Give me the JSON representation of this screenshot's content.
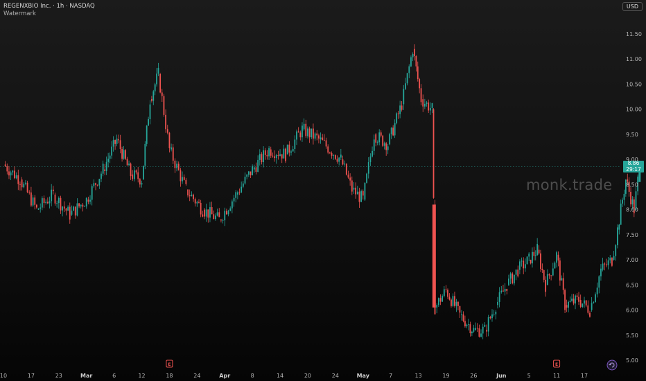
{
  "header": {
    "title": "REGENXBIO Inc. · 1h · NASDAQ",
    "subtitle": "Watermark",
    "currency": "USD"
  },
  "watermark": "monk.trade",
  "last_price": {
    "value": "8.86",
    "countdown": "29:17"
  },
  "events": [
    {
      "label": "E",
      "x_index": 6
    },
    {
      "label": "E",
      "x_index": 20
    }
  ],
  "colors": {
    "up": "#26a69a",
    "down": "#ef5350",
    "grid": "#2a2a2a",
    "axis_text": "#b4b4b4"
  },
  "chart_data": {
    "type": "candlestick",
    "title": "",
    "y_axis": {
      "ticks": [
        5.0,
        5.5,
        6.0,
        6.5,
        7.0,
        7.5,
        8.0,
        8.5,
        9.0,
        9.5,
        10.0,
        10.5,
        11.0,
        11.5
      ],
      "range": [
        5.0,
        11.9
      ]
    },
    "x_axis": {
      "ticks": [
        "10",
        "17",
        "23",
        "Mar",
        "6",
        "12",
        "18",
        "24",
        "Apr",
        "8",
        "14",
        "20",
        "24",
        "May",
        "7",
        "13",
        "19",
        "26",
        "Jun",
        "5",
        "11",
        "17"
      ],
      "major": [
        "Mar",
        "Apr",
        "May",
        "Jun"
      ]
    },
    "price_path": [
      [
        0,
        8.9
      ],
      [
        0.6,
        8.6
      ],
      [
        1.2,
        8.0
      ],
      [
        1.8,
        8.3
      ],
      [
        2.4,
        7.9
      ],
      [
        3,
        8.2
      ],
      [
        3.6,
        8.8
      ],
      [
        4.1,
        9.4
      ],
      [
        4.6,
        8.7
      ],
      [
        5.0,
        8.6
      ],
      [
        5.3,
        10.2
      ],
      [
        5.6,
        10.7
      ],
      [
        6.0,
        9.2
      ],
      [
        6.6,
        8.4
      ],
      [
        7.2,
        8.0
      ],
      [
        7.8,
        7.8
      ],
      [
        8.4,
        8.3
      ],
      [
        9.0,
        8.8
      ],
      [
        9.6,
        9.2
      ],
      [
        10.2,
        9.1
      ],
      [
        10.8,
        9.6
      ],
      [
        11.4,
        9.4
      ],
      [
        12.2,
        9.0
      ],
      [
        12.6,
        8.4
      ],
      [
        13.0,
        8.2
      ],
      [
        13.4,
        9.5
      ],
      [
        13.9,
        9.3
      ],
      [
        14.4,
        10.1
      ],
      [
        14.8,
        11.2
      ],
      [
        15.1,
        10.2
      ],
      [
        15.5,
        10.0
      ],
      [
        15.55,
        8.1
      ],
      [
        15.6,
        6.05
      ],
      [
        16.0,
        6.4
      ],
      [
        16.5,
        5.9
      ],
      [
        17.0,
        5.6
      ],
      [
        17.4,
        5.6
      ],
      [
        17.8,
        6.1
      ],
      [
        18.2,
        6.5
      ],
      [
        18.6,
        6.8
      ],
      [
        19.0,
        7.0
      ],
      [
        19.3,
        7.2
      ],
      [
        19.6,
        6.5
      ],
      [
        20.0,
        7.1
      ],
      [
        20.3,
        6.1
      ],
      [
        20.8,
        6.2
      ],
      [
        21.2,
        6.0
      ],
      [
        21.6,
        6.8
      ],
      [
        22.0,
        7.0
      ],
      [
        22.2,
        7.6
      ],
      [
        22.5,
        8.6
      ],
      [
        22.8,
        8.0
      ],
      [
        23.0,
        8.86
      ]
    ]
  }
}
